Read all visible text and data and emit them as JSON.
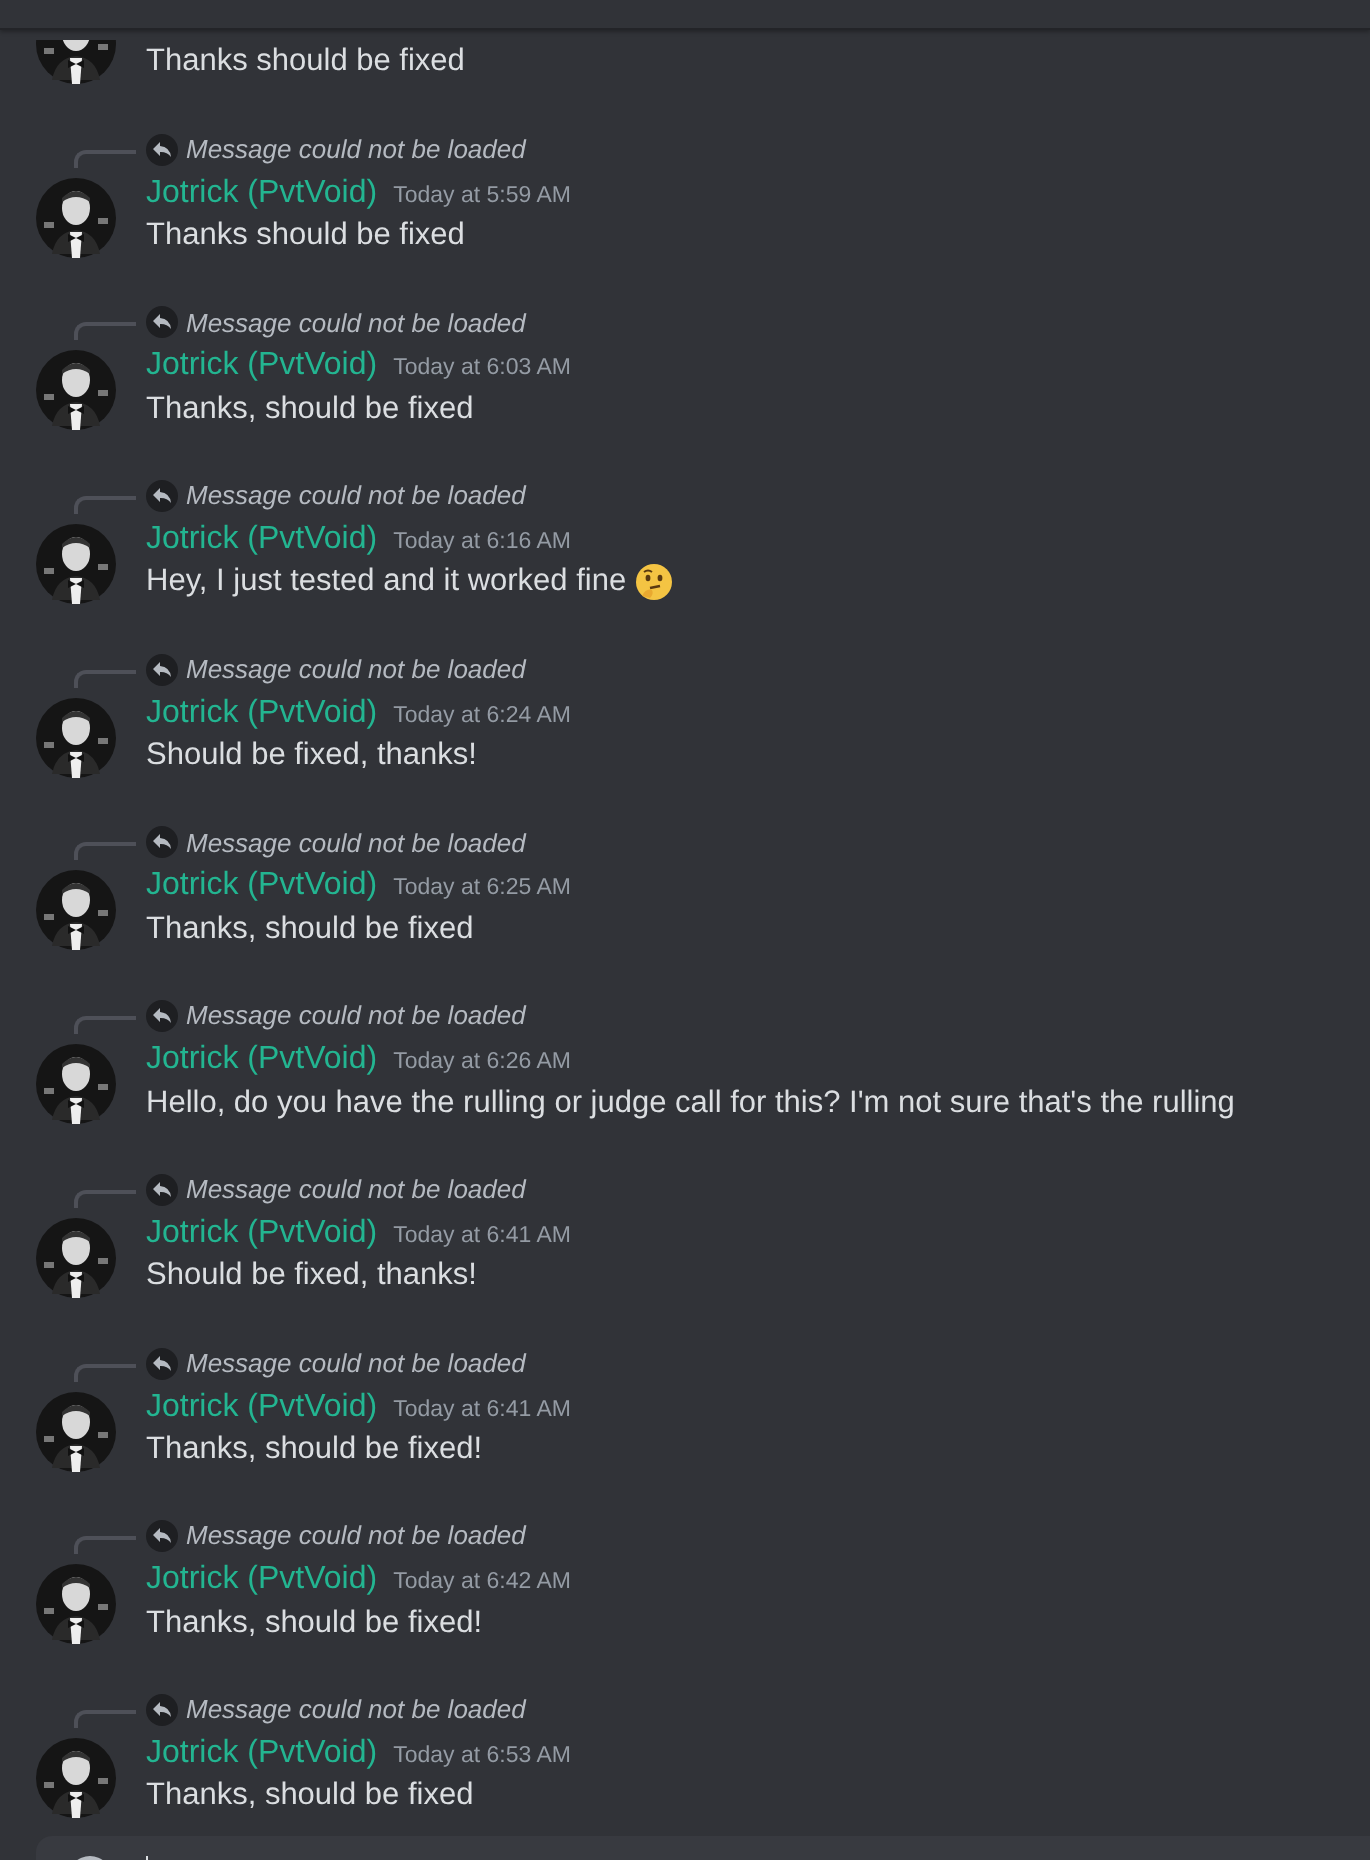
{
  "top_message": {
    "text": "Thanks should be fixed"
  },
  "messages": [
    {
      "reply": "Message could not be loaded",
      "author": "Jotrick (PvtVoid)",
      "time": "Today at 5:59 AM",
      "text": "Thanks should be fixed",
      "emoji": false
    },
    {
      "reply": "Message could not be loaded",
      "author": "Jotrick (PvtVoid)",
      "time": "Today at 6:03 AM",
      "text": "Thanks, should be fixed",
      "emoji": false
    },
    {
      "reply": "Message could not be loaded",
      "author": "Jotrick (PvtVoid)",
      "time": "Today at 6:16 AM",
      "text": "Hey, I just tested and it worked fine",
      "emoji": true
    },
    {
      "reply": "Message could not be loaded",
      "author": "Jotrick (PvtVoid)",
      "time": "Today at 6:24 AM",
      "text": "Should be fixed, thanks!",
      "emoji": false
    },
    {
      "reply": "Message could not be loaded",
      "author": "Jotrick (PvtVoid)",
      "time": "Today at 6:25 AM",
      "text": "Thanks, should be fixed",
      "emoji": false
    },
    {
      "reply": "Message could not be loaded",
      "author": "Jotrick (PvtVoid)",
      "time": "Today at 6:26 AM",
      "text": "Hello, do you have the rulling or judge call for this? I'm not sure that's the rulling",
      "emoji": false
    },
    {
      "reply": "Message could not be loaded",
      "author": "Jotrick (PvtVoid)",
      "time": "Today at 6:41 AM",
      "text": "Should be fixed, thanks!",
      "emoji": false
    },
    {
      "reply": "Message could not be loaded",
      "author": "Jotrick (PvtVoid)",
      "time": "Today at 6:41 AM",
      "text": "Thanks, should be fixed!",
      "emoji": false
    },
    {
      "reply": "Message could not be loaded",
      "author": "Jotrick (PvtVoid)",
      "time": "Today at 6:42 AM",
      "text": "Thanks, should be fixed!",
      "emoji": false
    },
    {
      "reply": "Message could not be loaded",
      "author": "Jotrick (PvtVoid)",
      "time": "Today at 6:53 AM",
      "text": "Thanks, should be fixed",
      "emoji": false
    }
  ]
}
